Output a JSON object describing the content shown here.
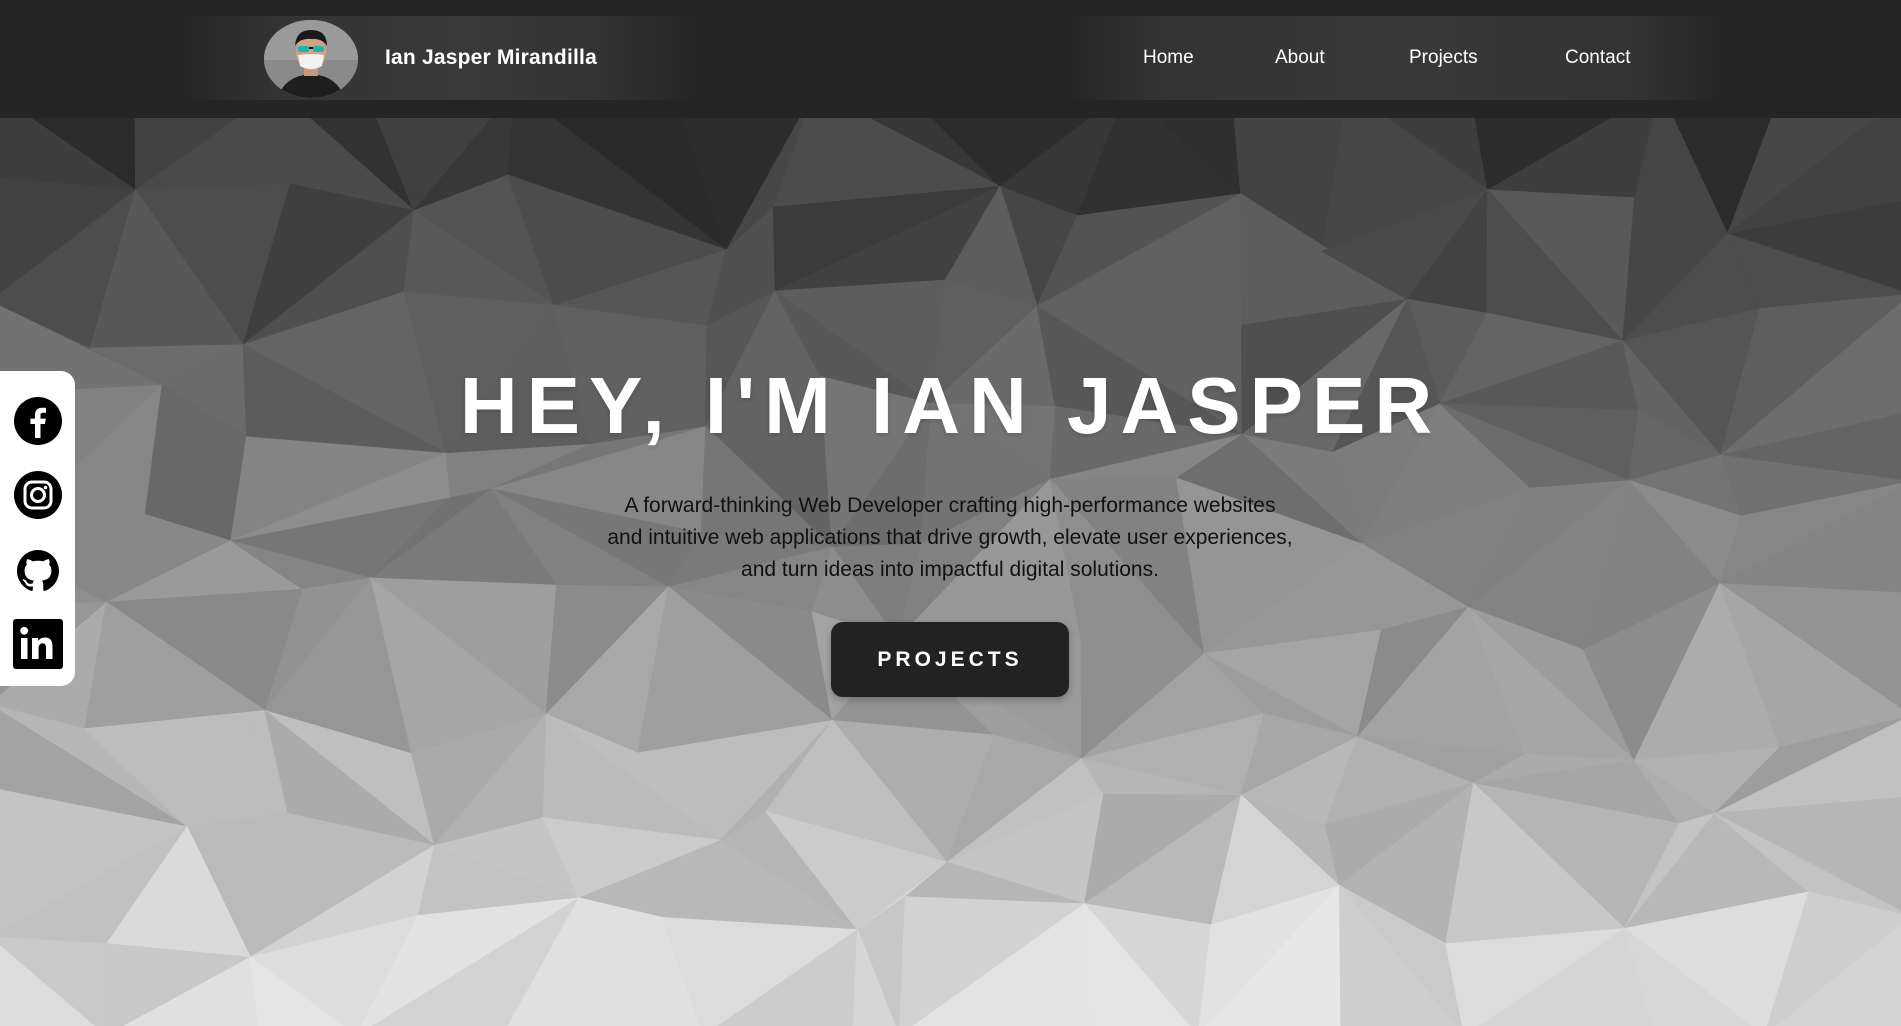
{
  "header": {
    "brand_name": "Ian Jasper Mirandilla",
    "nav": [
      {
        "label": "Home"
      },
      {
        "label": "About"
      },
      {
        "label": "Projects"
      },
      {
        "label": "Contact"
      }
    ]
  },
  "social": [
    {
      "icon": "facebook-icon"
    },
    {
      "icon": "instagram-icon"
    },
    {
      "icon": "github-icon"
    },
    {
      "icon": "linkedin-icon"
    }
  ],
  "hero": {
    "title": "HEY, I'M IAN JASPER",
    "subtitle_lines": [
      "A forward-thinking Web Developer crafting high-performance websites",
      "and intuitive web applications that drive growth, elevate user experiences,",
      "and turn ideas into impactful digital solutions."
    ],
    "cta_label": "PROJECTS"
  },
  "colors": {
    "header_bg": "#252525",
    "button_bg": "#222222",
    "title_color": "#ffffff",
    "subtitle_color": "#111111"
  }
}
